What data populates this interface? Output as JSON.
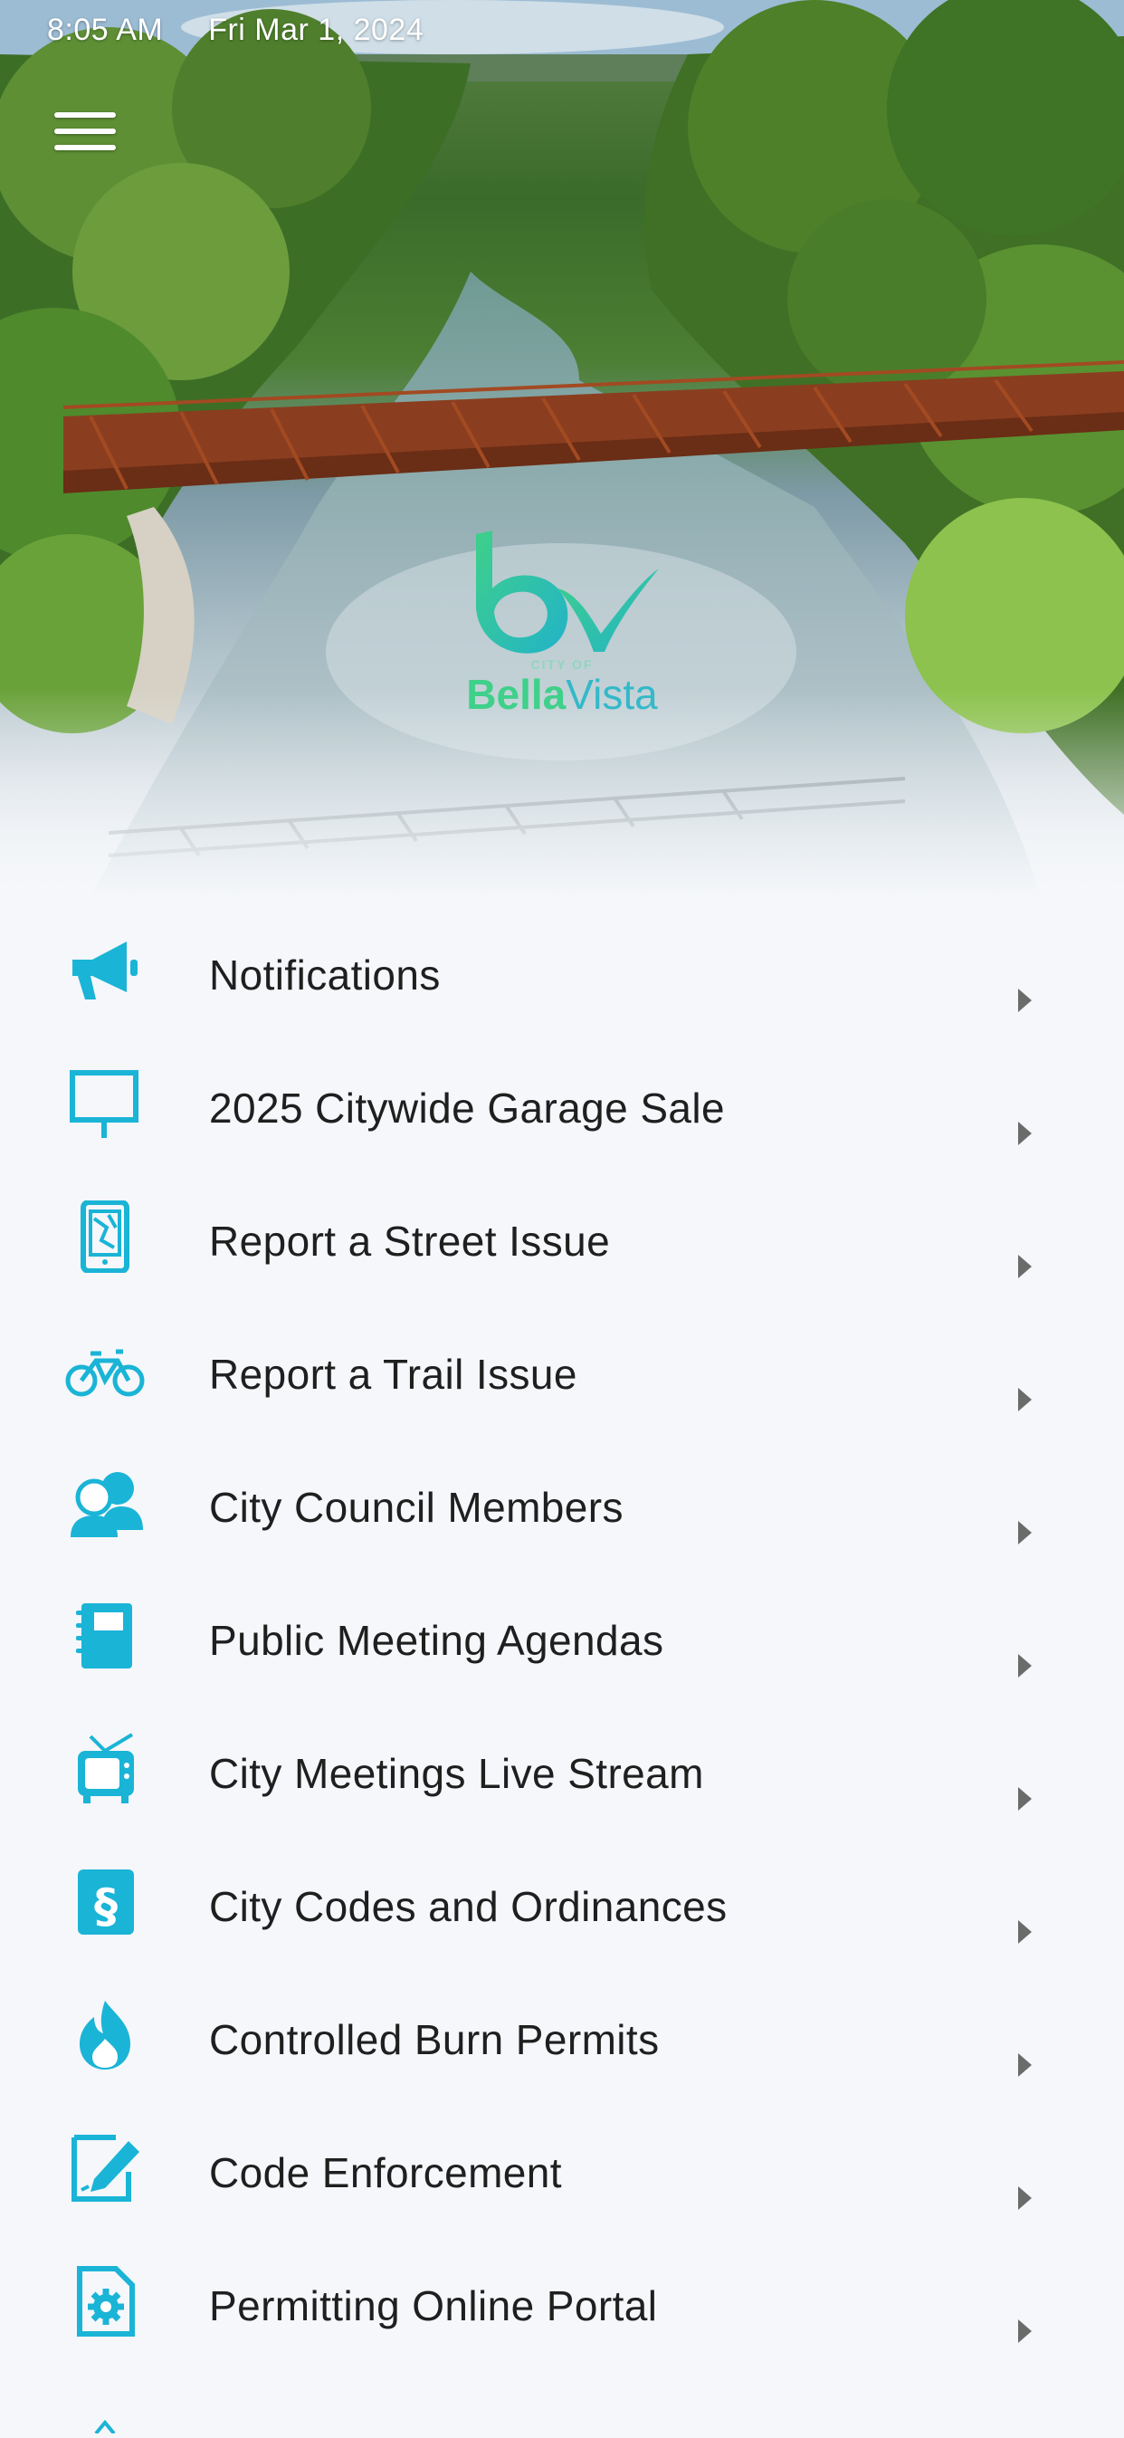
{
  "status_bar": {
    "time": "8:05 AM",
    "date": "Fri Mar 1, 2024"
  },
  "header": {
    "menu_icon": "hamburger-menu-icon",
    "logo": {
      "small_text": "CITY OF",
      "name_bold": "Bella",
      "name_light": "Vista"
    },
    "hero_image": "river-bridge-aerial-photo"
  },
  "colors": {
    "accent": "#1ab4d6",
    "logo_green": "#3fd08a",
    "logo_teal": "#33b9c9",
    "background": "#f5f7fa",
    "text": "#1f1f1f",
    "chevron": "#6b6b6b"
  },
  "menu": {
    "items": [
      {
        "label": "Notifications",
        "icon": "megaphone-icon"
      },
      {
        "label": "2025 Citywide Garage Sale",
        "icon": "signboard-icon"
      },
      {
        "label": "Report a Street Issue",
        "icon": "phone-map-icon"
      },
      {
        "label": "Report a Trail Issue",
        "icon": "bicycle-icon"
      },
      {
        "label": "City Council Members",
        "icon": "people-icon"
      },
      {
        "label": "Public Meeting Agendas",
        "icon": "notebook-icon"
      },
      {
        "label": "City Meetings Live Stream",
        "icon": "tv-icon"
      },
      {
        "label": "City Codes and Ordinances",
        "icon": "section-book-icon"
      },
      {
        "label": "Controlled Burn Permits",
        "icon": "flame-icon"
      },
      {
        "label": "Code Enforcement",
        "icon": "edit-document-icon"
      },
      {
        "label": "Permitting Online Portal",
        "icon": "gear-document-icon"
      }
    ]
  }
}
